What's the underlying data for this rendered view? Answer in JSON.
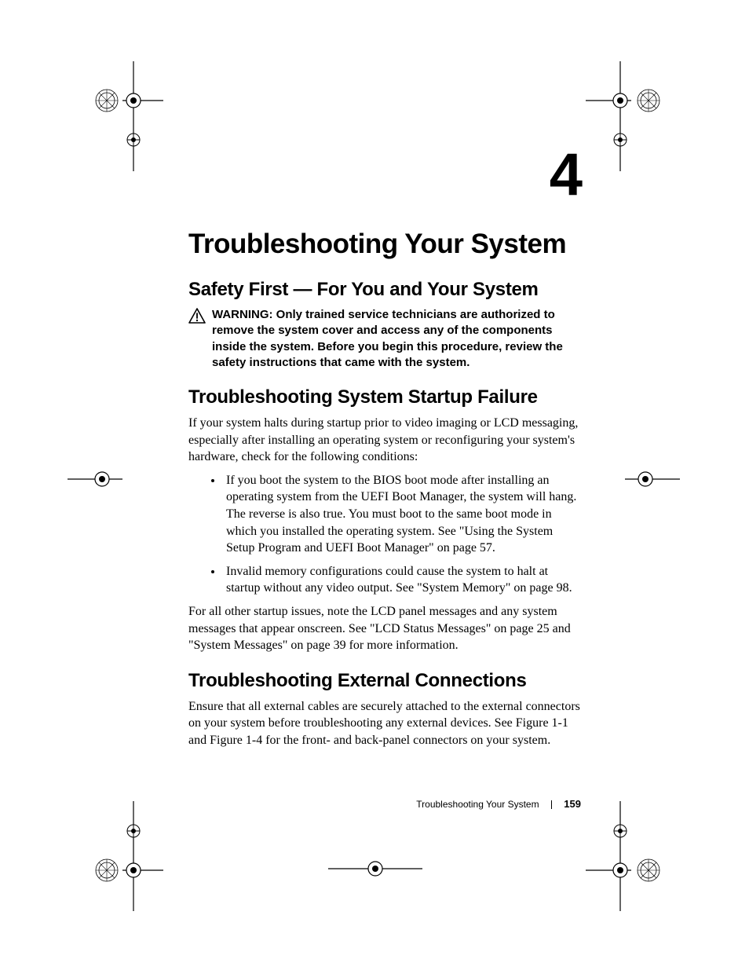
{
  "chapter_number": "4",
  "chapter_title": "Troubleshooting Your System",
  "sections": {
    "safety": {
      "heading": "Safety First — For You and Your System",
      "warning_label": "WARNING:",
      "warning_body": "Only trained service technicians are authorized to remove the system cover and access any of the components inside the system. Before you begin this procedure, review the safety instructions that came with the system."
    },
    "startup": {
      "heading": "Troubleshooting System Startup Failure",
      "intro": "If your system halts during startup prior to video imaging or LCD messaging, especially after installing an operating system or reconfiguring your system's hardware, check for the following conditions:",
      "bullets": [
        "If you boot the system to the BIOS boot mode after installing an operating system from the UEFI Boot Manager, the system will hang. The reverse is also true. You must boot to the same boot mode in which you installed the operating system. See \"Using the System Setup Program and UEFI Boot Manager\" on page 57.",
        "Invalid memory configurations could cause the system to halt at startup without any video output. See \"System Memory\" on page 98."
      ],
      "outro": "For all other startup issues, note the LCD panel messages and any system messages that appear onscreen. See \"LCD Status Messages\" on page 25 and \"System Messages\" on page 39 for more information."
    },
    "external": {
      "heading": "Troubleshooting External Connections",
      "body": "Ensure that all external cables are securely attached to the external connectors on your system before troubleshooting any external devices. See Figure 1-1 and Figure 1-4 for the front- and back-panel connectors on your system."
    }
  },
  "footer": {
    "title": "Troubleshooting Your System",
    "page_number": "159"
  }
}
